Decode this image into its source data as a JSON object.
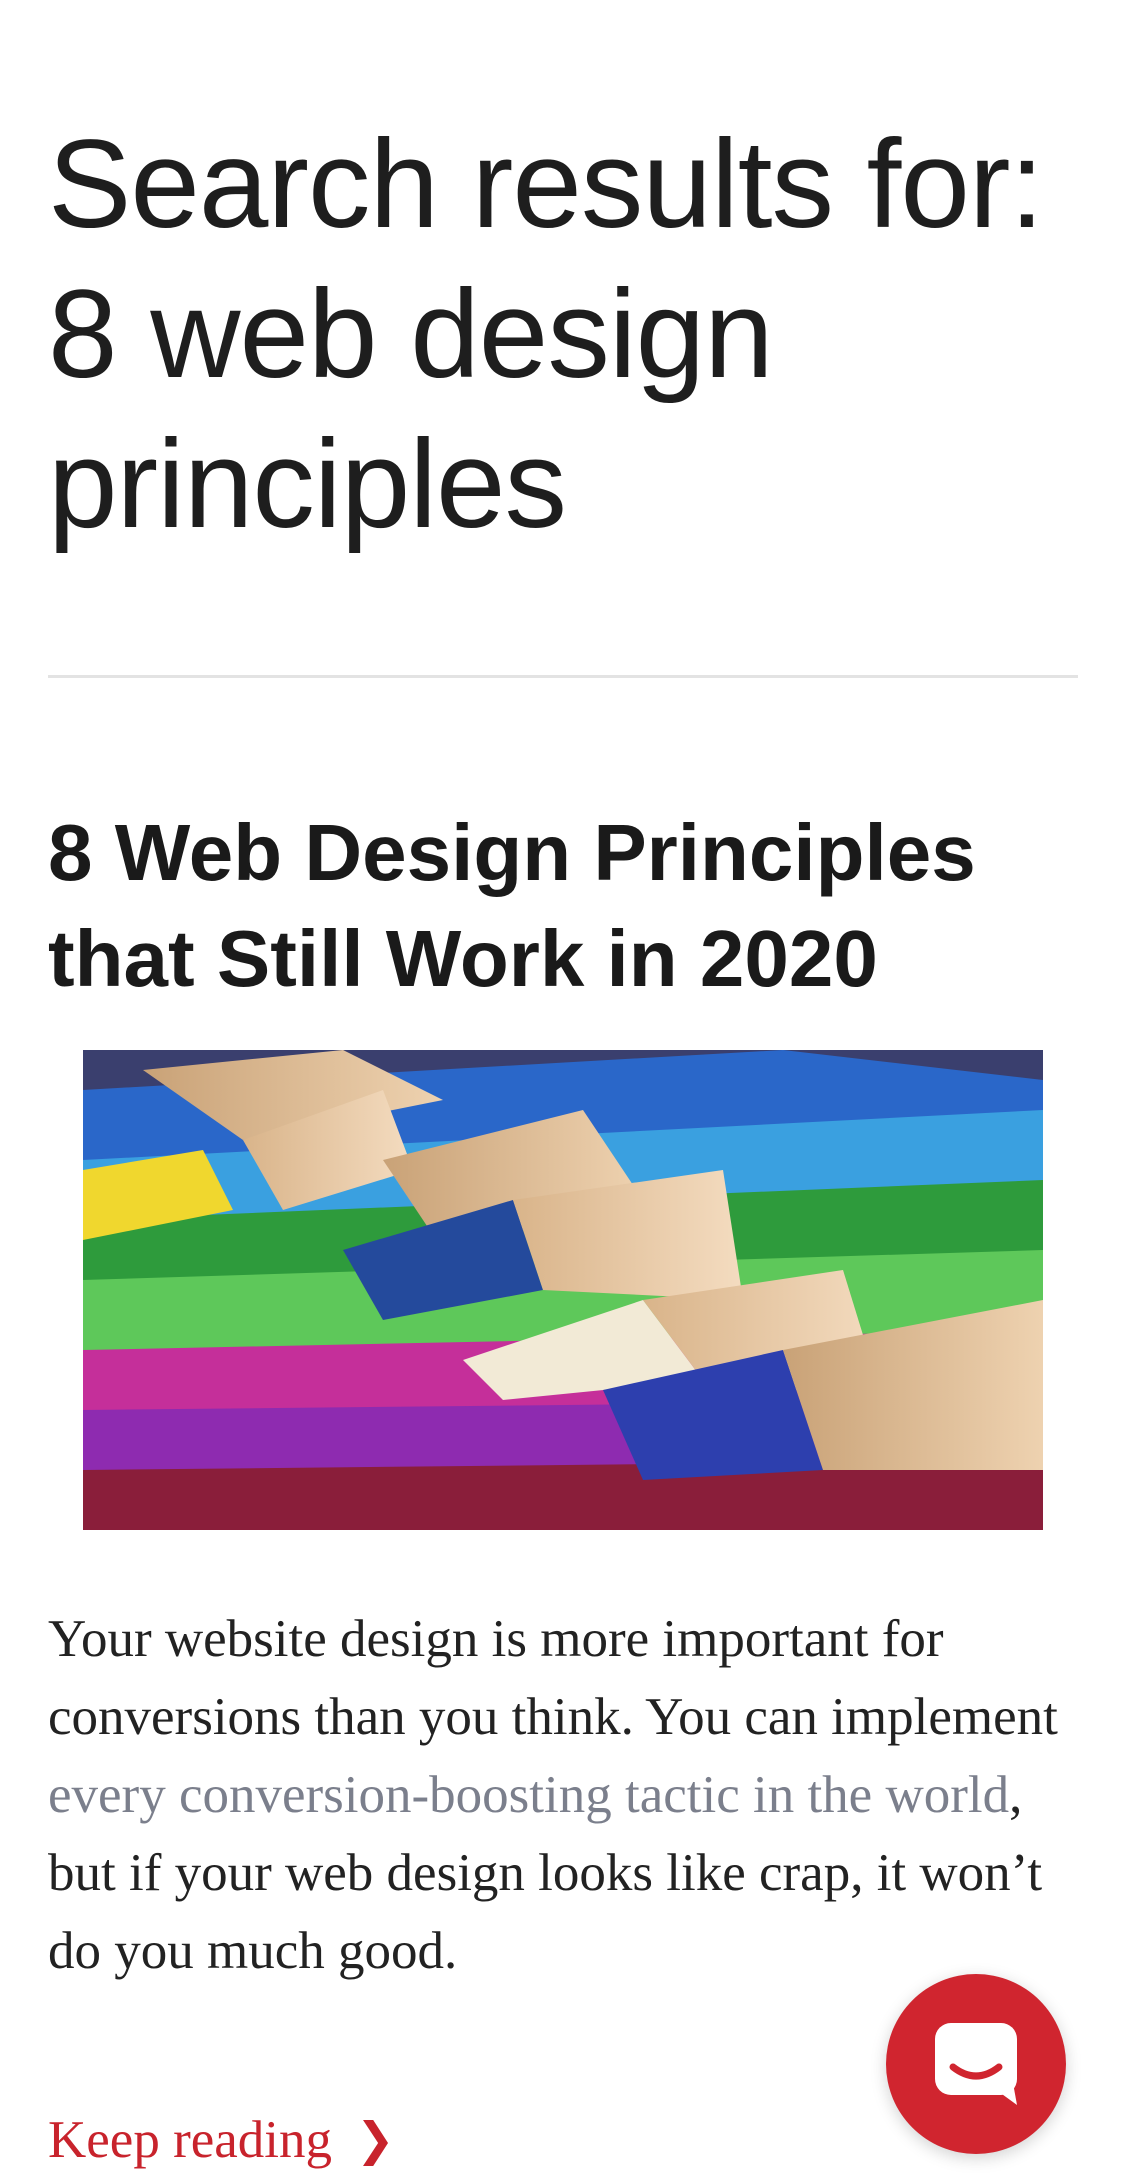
{
  "search": {
    "heading_lines": [
      "Search results for:",
      "8 web design",
      "principles"
    ]
  },
  "post": {
    "title_lines": [
      "8 Web Design Principles",
      "that Still Work in 2020"
    ],
    "image_icon": "colored-pencils-image",
    "excerpt": {
      "before_link": "Your website design is more important for conversions than you think. You can implement ",
      "link_text": "every conversion-boosting tactic in the world",
      "after_link": ", but if your web design looks like crap, it won’t do you much good."
    },
    "keep_reading_label": "Keep reading"
  },
  "chat_widget": {
    "icon": "chat-bubble-icon",
    "color": "#d0252f"
  },
  "colors": {
    "accent": "#c8232c",
    "link_muted": "#7b7f8c",
    "divider": "#e3e3e3"
  }
}
